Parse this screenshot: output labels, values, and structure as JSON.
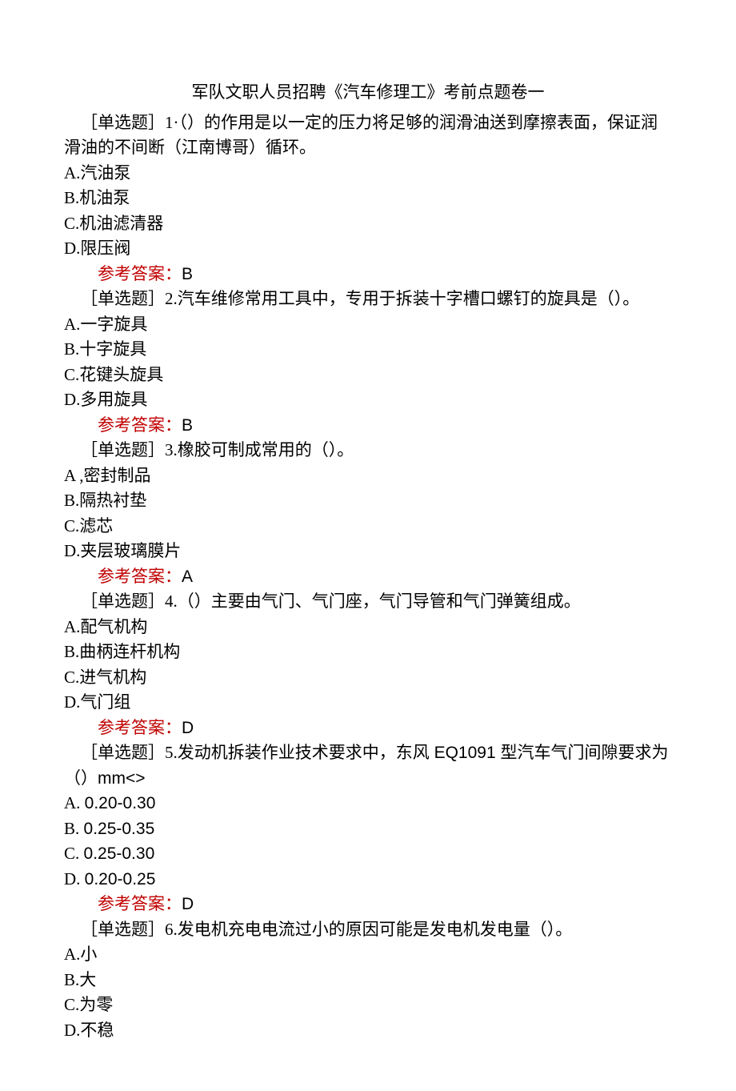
{
  "title": "军队文职人员招聘《汽车修理工》考前点题卷一",
  "q1": {
    "prefix": "［单选题］1·（）",
    "text_line1": "的作用是以一定的压力将足够的润滑油送到摩擦表面，保证润",
    "text_line2": "滑油的不间断（江南博哥）循环。",
    "optA": "A.汽油泵",
    "optB": "B.机油泵",
    "optC": "C.机油滤清器",
    "optD": "D.限压阀",
    "answer_label": "参考答案：",
    "answer_value": "B"
  },
  "q2": {
    "text": "［单选题］2.汽车维修常用工具中，专用于拆装十字槽口螺钉的旋具是（）。",
    "optA": "A.一字旋具",
    "optB": "B.十字旋具",
    "optC": "C.花键头旋具",
    "optD": "D.多用旋具",
    "answer_label": "参考答案：",
    "answer_value": "B"
  },
  "q3": {
    "text": "［单选题］3.橡胶可制成常用的（）。",
    "optA": "A ,密封制品",
    "optB": "B.隔热衬垫",
    "optC": "C.滤芯",
    "optD": "D.夹层玻璃膜片",
    "answer_label": "参考答案：",
    "answer_value": "A"
  },
  "q4": {
    "text": "［单选题］4.（）主要由气门、气门座，气门导管和气门弹簧组成。",
    "optA": "A.配气机构",
    "optB": "B.曲柄连杆机构",
    "optC": "C.进气机构",
    "optD": "D.气门组",
    "answer_label": "参考答案：",
    "answer_value": "D"
  },
  "q5": {
    "text_line1_pre": "［单选题］5.发动机拆装作业技术要求中，东风",
    "text_line1_mid": " EQ1091 ",
    "text_line1_post": "型汽车气门间隙要求为",
    "text_line2_pre": "（）",
    "text_line2_mid": "mm<>",
    "optA_pre": "A. ",
    "optA_val": "0.20-0.30",
    "optB_pre": "B. ",
    "optB_val": "0.25-0.35",
    "optC_pre": "C. ",
    "optC_val": "0.25-0.30",
    "optD_pre": "D. ",
    "optD_val": "0.20-0.25",
    "answer_label": "参考答案：",
    "answer_value": "D"
  },
  "q6": {
    "text": "［单选题］6.发电机充电电流过小的原因可能是发电机发电量（）。",
    "optA": "A.小",
    "optB": "B.大",
    "optC": "C.为零",
    "optD": "D.不稳"
  }
}
